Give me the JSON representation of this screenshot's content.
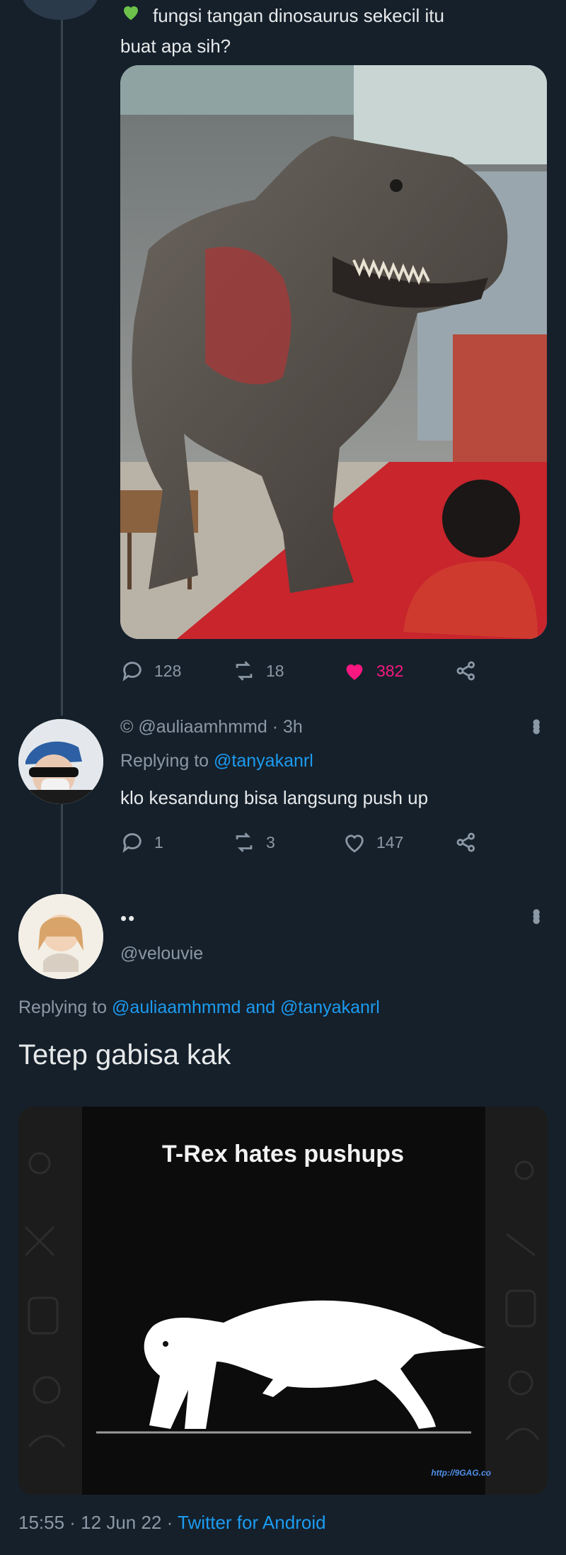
{
  "tweet1": {
    "text_line1": "fungsi tangan dinosaurus sekecil itu",
    "text_line2": "buat apa sih?",
    "stats": {
      "replies": "128",
      "retweets": "18",
      "likes": "382"
    }
  },
  "reply1": {
    "handle_line": "© @auliaamhmmd · 3h",
    "replying_label": "Replying to ",
    "replying_to": "@tanyakanrl",
    "text": "klo kesandung bisa langsung push up",
    "stats": {
      "replies": "1",
      "retweets": "3",
      "likes": "147"
    }
  },
  "reply2": {
    "name": "••",
    "handle": "@velouvie",
    "replying_label": "Replying to ",
    "replying_to_1": "@auliaamhmmd",
    "replying_and": " and ",
    "replying_to_2": "@tanyakanrl",
    "text": "Tetep gabisa kak",
    "image_caption": "T-Rex hates pushups",
    "image_watermark": "http://9GAG.co",
    "footer": {
      "time": "15:55 · 12 Jun 22 · ",
      "client": "Twitter for Android"
    }
  },
  "colors": {
    "background": "#15202b",
    "text": "#e7e9ea",
    "muted": "#8b98a5",
    "link": "#1d9bf0",
    "like": "#f91880"
  },
  "icons": [
    "green-heart-icon",
    "reply-icon",
    "retweet-icon",
    "like-icon",
    "share-icon",
    "more-icon"
  ]
}
